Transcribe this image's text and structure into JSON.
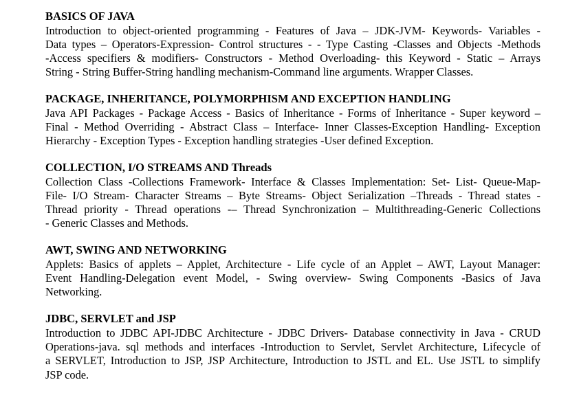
{
  "sections": [
    {
      "title": "BASICS OF JAVA",
      "lines": [
        "Introduction to object-oriented programming - Features of Java – JDK-JVM- Keywords- Variables -",
        "Data types – Operators-Expression- Control structures - - Type Casting -Classes and Objects -Methods",
        "-Access specifiers & modifiers- Constructors - Method Overloading- this Keyword - Static – Arrays",
        "String - String Buffer-String handling mechanism-Command line arguments. Wrapper Classes."
      ]
    },
    {
      "title": "PACKAGE, INHERITANCE, POLYMORPHISM AND EXCEPTION HANDLING",
      "lines": [
        "Java API Packages - Package Access - Basics of Inheritance - Forms of Inheritance - Super keyword –",
        "Final - Method Overriding - Abstract Class – Interface- Inner Classes-Exception Handling- Exception",
        "Hierarchy - Exception Types - Exception handling strategies -User defined Exception."
      ]
    },
    {
      "title": "COLLECTION, I/O STREAMS AND Threads",
      "lines": [
        "Collection Class -Collections Framework- Interface & Classes Implementation: Set- List- Queue-Map-",
        "File- I/O Stream- Character Streams – Byte Streams- Object Serialization –Threads - Thread states -",
        "Thread priority - Thread operations -– Thread Synchronization – Multithreading-Generic Collections",
        "- Generic Classes and Methods."
      ]
    },
    {
      "title": "AWT, SWING AND NETWORKING",
      "lines": [
        "Applets: Basics of applets – Applet, Architecture - Life cycle of an Applet – AWT, Layout Manager:",
        "Event Handling-Delegation event Model, - Swing overview- Swing Components -Basics of Java",
        "Networking."
      ]
    },
    {
      "title": "JDBC, SERVLET and JSP",
      "lines": [
        "Introduction to JDBC API-JDBC Architecture - JDBC Drivers- Database connectivity in Java - CRUD",
        "Operations-java. sql methods and interfaces -Introduction to Servlet, Servlet Architecture, Lifecycle of",
        "a SERVLET, Introduction to JSP, JSP Architecture, Introduction to JSTL and EL. Use JSTL to simplify",
        "JSP code."
      ]
    }
  ]
}
